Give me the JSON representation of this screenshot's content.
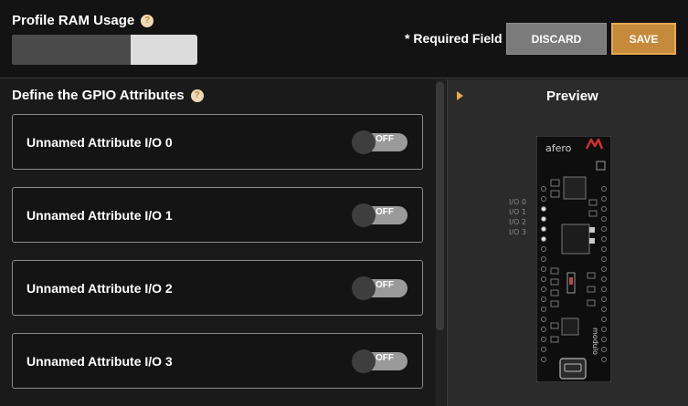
{
  "header": {
    "ram_label": "Profile RAM Usage",
    "ram_usage_fraction": 0.64,
    "required_label": "* Required Field",
    "discard_label": "DISCARD",
    "save_label": "SAVE",
    "help_glyph": "?"
  },
  "gpio": {
    "title": "Define the GPIO Attributes",
    "attributes": [
      {
        "label": "Unnamed Attribute I/O 0",
        "toggle": "OFF"
      },
      {
        "label": "Unnamed Attribute I/O 1",
        "toggle": "OFF"
      },
      {
        "label": "Unnamed Attribute I/O 2",
        "toggle": "OFF"
      },
      {
        "label": "Unnamed Attribute I/O 3",
        "toggle": "OFF"
      }
    ]
  },
  "preview": {
    "title": "Preview",
    "board_brand": "afero",
    "board_side_text": "modulo",
    "pin_labels": [
      "I/O 0",
      "I/O 1",
      "I/O 2",
      "I/O 3"
    ]
  },
  "colors": {
    "accent": "#c58a3c",
    "discard": "#7b7b7b",
    "toggle_off": "#9a9a9a"
  },
  "icons": {
    "help": "question-circle-icon",
    "expand": "caret-right-icon"
  }
}
